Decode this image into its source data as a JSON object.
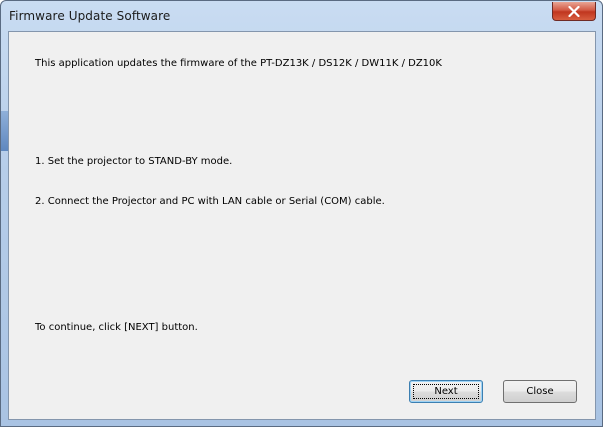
{
  "window": {
    "title": "Firmware Update Software"
  },
  "content": {
    "intro": "This application updates the firmware of the PT-DZ13K / DS12K / DW11K / DZ10K",
    "step1": "1. Set the projector to STAND-BY mode.",
    "step2": "2. Connect the Projector and PC with LAN cable or Serial (COM) cable.",
    "continue": "To continue, click [NEXT] button."
  },
  "buttons": {
    "next_label": "Next",
    "close_label": "Close"
  },
  "icons": {
    "title_close": "close-icon"
  },
  "colors": {
    "titlebar": "#b6cde9",
    "client_bg": "#f0f0f0",
    "close_button": "#c0361f"
  }
}
